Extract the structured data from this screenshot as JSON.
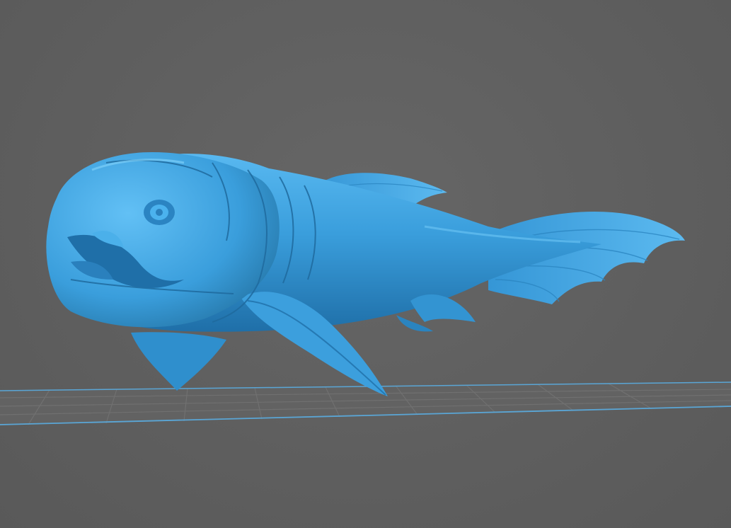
{
  "viewport": {
    "background_color": "#5f5f5f",
    "grid_color": "#6f6f6f",
    "grid_edge_color": "#5aa6d6",
    "model_color": "#3aa0e0"
  },
  "scene": {
    "model_icon": "fish-model-icon",
    "plate_icon": "build-plate-grid-icon"
  }
}
